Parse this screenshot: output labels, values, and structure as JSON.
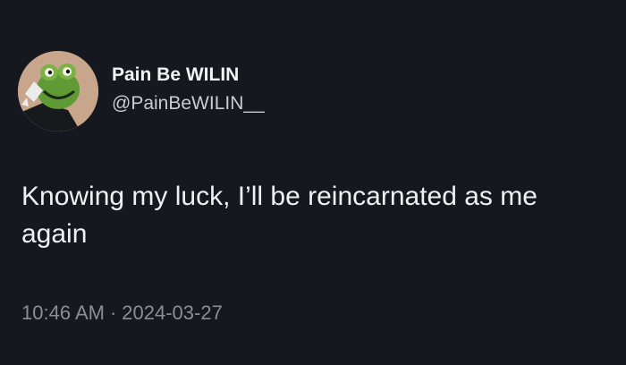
{
  "user": {
    "display_name": "Pain Be WILIN",
    "handle": "@PainBeWILIN__",
    "avatar_icon": "kermit-frog-avatar"
  },
  "tweet": {
    "text": "Knowing my luck, I’ll be reincarnated as me again",
    "time": "10:46 AM",
    "separator": "·",
    "date": "2024-03-27"
  },
  "colors": {
    "background": "#15181e",
    "primary_text": "#e7e9ea",
    "secondary_text": "#8a8f95"
  }
}
